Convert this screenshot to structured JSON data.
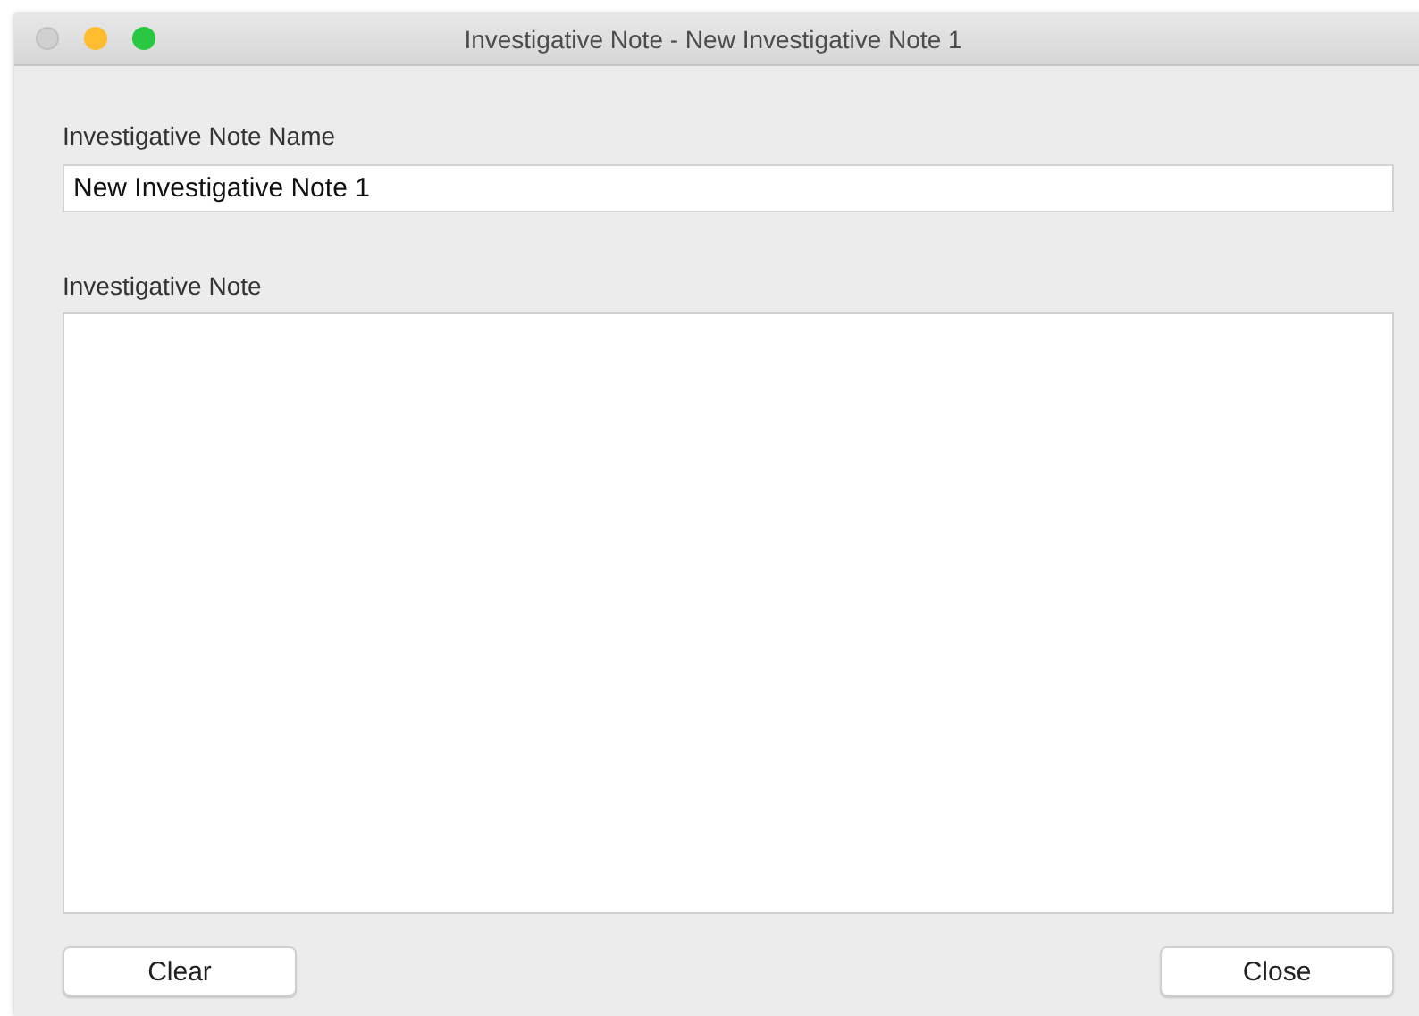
{
  "window": {
    "title": "Investigative Note - New Investigative Note 1",
    "controls": [
      {
        "kind": "close",
        "disabled": true
      },
      {
        "kind": "minimize",
        "disabled": false
      },
      {
        "kind": "zoom",
        "disabled": false
      }
    ]
  },
  "name_field": {
    "label": "Investigative Note Name",
    "value": "New Investigative Note 1"
  },
  "note_field": {
    "label": "Investigative Note"
  },
  "buttons": [
    {
      "label": "Clear"
    },
    {
      "label": "Close"
    }
  ]
}
